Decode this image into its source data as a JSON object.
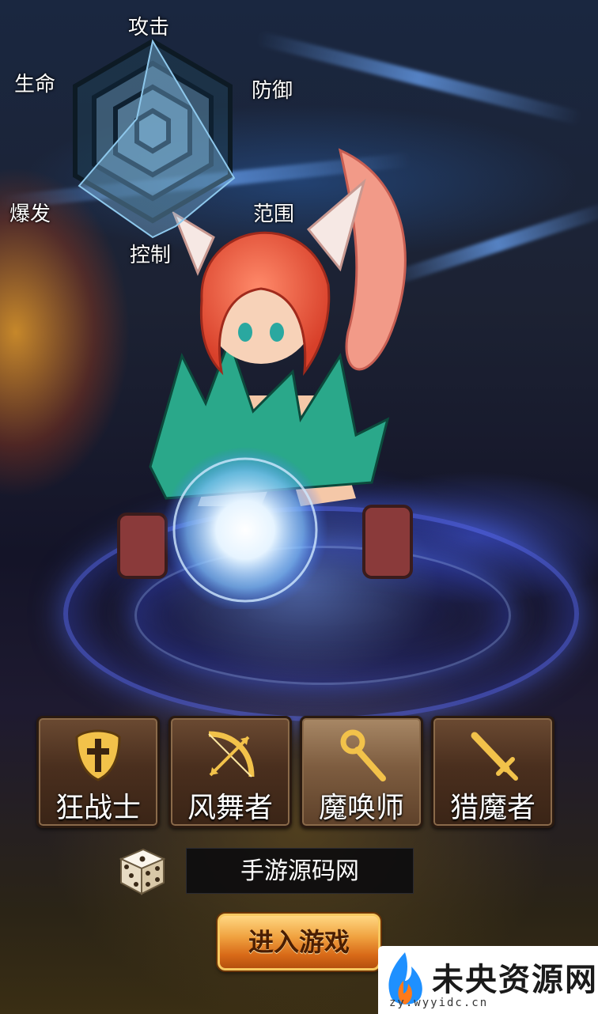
{
  "radar": {
    "labels": {
      "attack": "攻击",
      "defense": "防御",
      "range": "范围",
      "control": "控制",
      "burst": "爆发",
      "life": "生命"
    }
  },
  "classes": [
    {
      "label": "狂战士",
      "icon": "shield-cross-icon",
      "selected": false
    },
    {
      "label": "风舞者",
      "icon": "bow-icon",
      "selected": false
    },
    {
      "label": "魔唤师",
      "icon": "staff-icon",
      "selected": true
    },
    {
      "label": "猎魔者",
      "icon": "sword-icon",
      "selected": false
    }
  ],
  "character_name": "手游源码网",
  "random_name_icon": "dice-icon",
  "enter_button_label": "进入游戏",
  "watermark": {
    "text": "未央资源网",
    "url": "zy.wyyidc.cn"
  },
  "colors": {
    "accent_gold": "#ffd782",
    "button_brown": "#4a2f1e"
  }
}
